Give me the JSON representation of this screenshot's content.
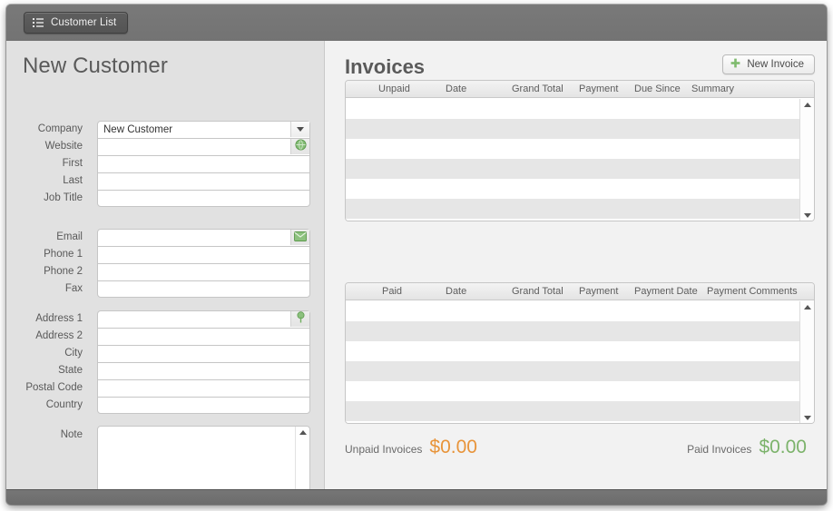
{
  "toolbar": {
    "customer_list_tab": "Customer List",
    "list_icon": "list-icon"
  },
  "left_panel": {
    "title": "New Customer",
    "groups": [
      {
        "name": "identity",
        "fields": [
          {
            "label": "Company",
            "value": "New Customer",
            "placeholder": "",
            "control": "dropdown"
          },
          {
            "label": "Website",
            "value": "",
            "placeholder": "",
            "control": "action",
            "action_icon": "globe-icon"
          },
          {
            "label": "First",
            "value": "",
            "placeholder": "",
            "control": "text"
          },
          {
            "label": "Last",
            "value": "",
            "placeholder": "",
            "control": "text"
          },
          {
            "label": "Job Title",
            "value": "",
            "placeholder": "",
            "control": "text"
          }
        ]
      },
      {
        "name": "contact",
        "fields": [
          {
            "label": "Email",
            "value": "",
            "placeholder": "",
            "control": "action",
            "action_icon": "envelope-icon"
          },
          {
            "label": "Phone 1",
            "value": "",
            "placeholder": "",
            "control": "text"
          },
          {
            "label": "Phone 2",
            "value": "",
            "placeholder": "",
            "control": "text"
          },
          {
            "label": "Fax",
            "value": "",
            "placeholder": "",
            "control": "text"
          }
        ]
      },
      {
        "name": "address",
        "fields": [
          {
            "label": "Address 1",
            "value": "",
            "placeholder": "",
            "control": "action",
            "action_icon": "map-pin-icon"
          },
          {
            "label": "Address 2",
            "value": "",
            "placeholder": "",
            "control": "text"
          },
          {
            "label": "City",
            "value": "",
            "placeholder": "",
            "control": "text"
          },
          {
            "label": "State",
            "value": "",
            "placeholder": "",
            "control": "text"
          },
          {
            "label": "Postal Code",
            "value": "",
            "placeholder": "",
            "control": "text"
          },
          {
            "label": "Country",
            "value": "",
            "placeholder": "",
            "control": "text"
          }
        ]
      }
    ],
    "note": {
      "label": "Note",
      "value": "",
      "placeholder": ""
    }
  },
  "right_panel": {
    "title": "Invoices",
    "new_invoice_button": "New Invoice",
    "new_invoice_icon": "plus-icon",
    "unpaid_table": {
      "columns": [
        "Unpaid",
        "Date",
        "Grand Total",
        "Payment",
        "Due Since",
        "Summary"
      ],
      "rows": []
    },
    "paid_table": {
      "columns": [
        "Paid",
        "Date",
        "Grand Total",
        "Payment",
        "Payment Date",
        "Payment Comments"
      ],
      "rows": []
    },
    "totals": {
      "unpaid_label": "Unpaid Invoices",
      "unpaid_amount": "$0.00",
      "unpaid_color": "#e8943a",
      "paid_label": "Paid Invoices",
      "paid_amount": "$0.00",
      "paid_color": "#7cb36b"
    }
  }
}
